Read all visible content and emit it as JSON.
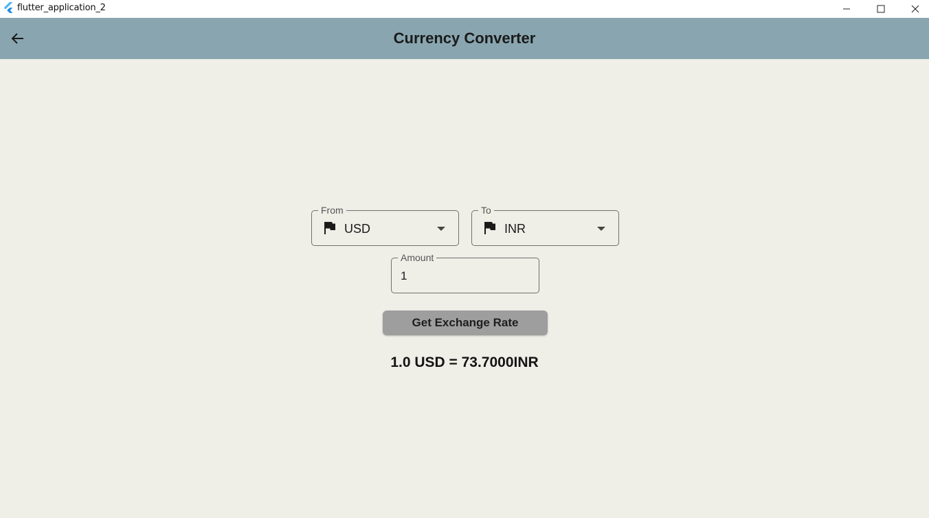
{
  "window": {
    "title": "flutter_application_2",
    "icons": {
      "logo": "flutter-logo",
      "minimize": "minimize-icon",
      "maximize": "maximize-icon",
      "close": "close-icon"
    }
  },
  "appbar": {
    "title": "Currency Converter",
    "back_icon": "arrow-back-icon",
    "color": "#89a6b0"
  },
  "form": {
    "from": {
      "label": "From",
      "value": "USD",
      "icon": "flag-icon"
    },
    "to": {
      "label": "To",
      "value": "INR",
      "icon": "flag-icon"
    },
    "amount": {
      "label": "Amount",
      "value": "1"
    },
    "button_label": "Get Exchange Rate",
    "result": "1.0 USD = 73.7000INR"
  },
  "colors": {
    "background": "#efeee7",
    "button": "#9e9e9e"
  }
}
